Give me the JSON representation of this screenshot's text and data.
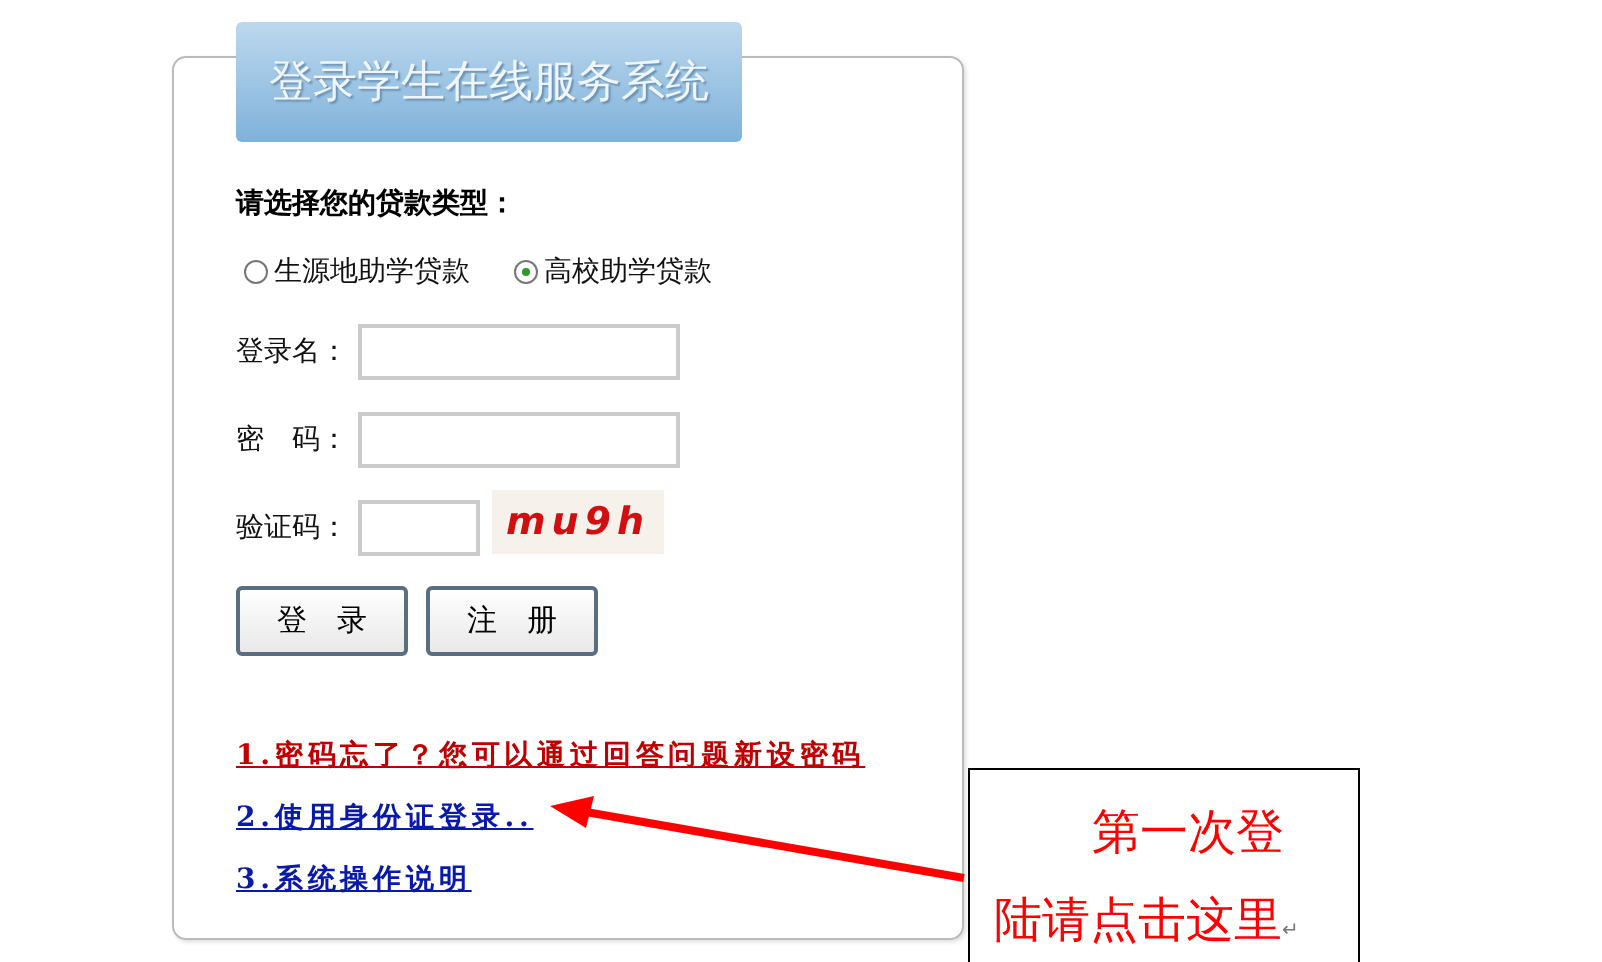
{
  "header": {
    "title": "登录学生在线服务系统"
  },
  "loan_type": {
    "label": "请选择您的贷款类型：",
    "options": [
      {
        "label": "生源地助学贷款",
        "selected": false
      },
      {
        "label": "高校助学贷款",
        "selected": true
      }
    ]
  },
  "fields": [
    {
      "label": "登录名：",
      "kind": "text"
    },
    {
      "label": "密　码：",
      "kind": "password"
    },
    {
      "label": "验证码：",
      "kind": "captcha",
      "captcha": "mu9h"
    }
  ],
  "buttons": [
    "登　录",
    "注　册"
  ],
  "links": [
    {
      "text": "1.密码忘了？您可以通过回答问题新设密码",
      "color": "#c00000"
    },
    {
      "text": "2.使用身份证登录..",
      "color": "#0a1aa8"
    },
    {
      "text": "3.系统操作说明",
      "color": "#0a1aa8"
    }
  ],
  "callout": {
    "lines": [
      "第一次登",
      "陆请点击这里"
    ],
    "paragraph_mark": "↵"
  }
}
